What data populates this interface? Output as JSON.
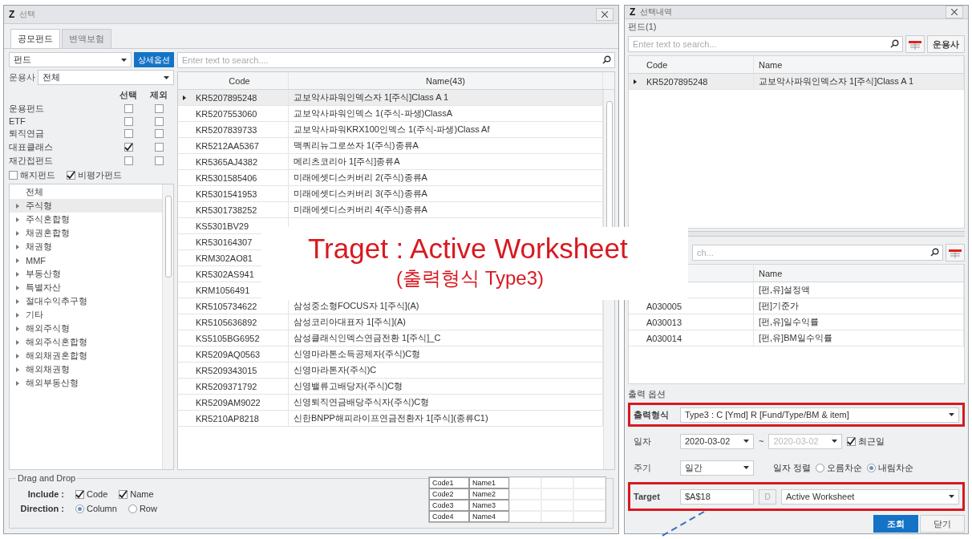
{
  "left_window": {
    "logo": "Z",
    "title": "선택",
    "tabs": [
      {
        "label": "공모펀드",
        "selected": true
      },
      {
        "label": "변액보험",
        "selected": false
      }
    ],
    "fund_type": {
      "value": "펀드"
    },
    "detail_button": "상세옵션",
    "manager": {
      "label": "운용사",
      "value": "전체"
    },
    "filter_headers": [
      "선택",
      "제외"
    ],
    "filters": [
      {
        "label": "운용펀드",
        "select": false,
        "exclude": false
      },
      {
        "label": "ETF",
        "select": false,
        "exclude": false
      },
      {
        "label": "퇴직연금",
        "select": false,
        "exclude": false
      },
      {
        "label": "대표클래스",
        "select": true,
        "exclude": false
      },
      {
        "label": "재간접펀드",
        "select": false,
        "exclude": false
      }
    ],
    "extra_checks": [
      {
        "label": "해지펀드",
        "checked": false
      },
      {
        "label": "비평가펀드",
        "checked": true
      }
    ],
    "categories": [
      {
        "label": "전체",
        "kind": "all",
        "selected": false
      },
      {
        "label": "주식형",
        "kind": "group",
        "selected": true
      },
      {
        "label": "주식혼합형",
        "kind": "group",
        "selected": false
      },
      {
        "label": "채권혼합형",
        "kind": "group",
        "selected": false
      },
      {
        "label": "채권형",
        "kind": "group",
        "selected": false
      },
      {
        "label": "MMF",
        "kind": "group",
        "selected": false
      },
      {
        "label": "부동산형",
        "kind": "group",
        "selected": false
      },
      {
        "label": "특별자산",
        "kind": "group",
        "selected": false
      },
      {
        "label": "절대수익추구형",
        "kind": "group",
        "selected": false
      },
      {
        "label": "기타",
        "kind": "group",
        "selected": false
      },
      {
        "label": "해외주식형",
        "kind": "group",
        "selected": false
      },
      {
        "label": "해외주식혼합형",
        "kind": "group",
        "selected": false
      },
      {
        "label": "해외채권혼합형",
        "kind": "group",
        "selected": false
      },
      {
        "label": "해외채권형",
        "kind": "group",
        "selected": false
      },
      {
        "label": "해외부동산형",
        "kind": "group",
        "selected": false
      }
    ],
    "search": {
      "placeholder": "Enter text to search...."
    },
    "table": {
      "columns": [
        "Code",
        "Name(43)"
      ],
      "rows": [
        {
          "code": "KR5207895248",
          "name": "교보악사파워인덱스자 1[주식]Class A 1",
          "current": true
        },
        {
          "code": "KR5207553060",
          "name": "교보악사파워인덱스 1(주식-파생)ClassA",
          "current": false
        },
        {
          "code": "KR5207839733",
          "name": "교보악사파워KRX100인덱스 1(주식-파생)Class Af",
          "current": false
        },
        {
          "code": "KR5212AA5367",
          "name": "맥쿼리뉴그로쓰자 1(주식)종류A",
          "current": false
        },
        {
          "code": "KR5365AJ4382",
          "name": "메리츠코리아 1[주식]종류A",
          "current": false
        },
        {
          "code": "KR5301585406",
          "name": "미래에셋디스커버리 2(주식)종류A",
          "current": false
        },
        {
          "code": "KR5301541953",
          "name": "미래에셋디스커버리 3(주식)종류A",
          "current": false
        },
        {
          "code": "KR5301738252",
          "name": "미래에셋디스커버리 4(주식)종류A",
          "current": false
        },
        {
          "code": "KS5301BV29",
          "current": false
        },
        {
          "code": "KR530164307",
          "current": false
        },
        {
          "code": "KRM302AO81",
          "current": false
        },
        {
          "code": "KR5302AS941",
          "current": false
        },
        {
          "code": "KRM1056491",
          "current": false
        },
        {
          "code": "KR5105734622",
          "name": "삼성중소형FOCUS자 1[주식](A)",
          "current": false
        },
        {
          "code": "KR5105636892",
          "name": "삼성코리아대표자 1[주식](A)",
          "current": false
        },
        {
          "code": "KS5105BG6952",
          "name": "삼성클래식인덱스연금전환 1[주식]_C",
          "current": false
        },
        {
          "code": "KR5209AQ0563",
          "name": "신영마라톤소득공제자(주식)C형",
          "current": false
        },
        {
          "code": "KR5209343015",
          "name": "신영마라톤자(주식)C",
          "current": false
        },
        {
          "code": "KR5209371792",
          "name": "신영밸류고배당자(주식)C형",
          "current": false
        },
        {
          "code": "KR5209AM9022",
          "name": "신영퇴직연금배당주식자(주식)C형",
          "current": false
        },
        {
          "code": "KR5210AP8218",
          "name": "신한BNPP해피라이프연금전환자 1[주식](종류C1)",
          "current": false
        }
      ]
    },
    "drag_drop": {
      "title": "Drag and Drop",
      "include": {
        "label": "Include :",
        "options": [
          {
            "label": "Code",
            "checked": true
          },
          {
            "label": "Name",
            "checked": true
          }
        ]
      },
      "direction": {
        "label": "Direction :",
        "options": [
          {
            "label": "Column",
            "selected": true
          },
          {
            "label": "Row",
            "selected": false
          }
        ]
      },
      "preview": [
        {
          "code": "Code1",
          "name": "Name1"
        },
        {
          "code": "Code2",
          "name": "Name2"
        },
        {
          "code": "Code3",
          "name": "Name3"
        },
        {
          "code": "Code4",
          "name": "Name4"
        }
      ]
    }
  },
  "right_window": {
    "logo": "Z",
    "title": "선택내역",
    "group_title": "펀드(1)",
    "search": {
      "placeholder": "Enter text to search..."
    },
    "manager_button": "운용사",
    "table": {
      "columns": [
        "Code",
        "Name"
      ],
      "rows": [
        {
          "code": "KR5207895248",
          "name": "교보악사파워인덱스자 1[주식]Class A 1",
          "current": true
        }
      ]
    },
    "items": {
      "search": {
        "placeholder": "ch..."
      },
      "name_header": "Name",
      "rows": [
        {
          "name": "[펀,유]설정액"
        },
        {
          "code": "A030005",
          "name": "[펀]기준가"
        },
        {
          "code": "A030013",
          "name": "[펀,유]일수익률"
        },
        {
          "code": "A030014",
          "name": "[펀,유]BM일수익률"
        }
      ]
    },
    "options": {
      "title": "출력 옵션",
      "format": {
        "label": "출력형식",
        "value": "Type3 : C [Ymd] R [Fund/Type/BM & item]",
        "highlighted": true
      },
      "date": {
        "label": "일자",
        "from": "2020-03-02",
        "separator": "~",
        "to": "2020-03-02",
        "latest": {
          "label": "최근일",
          "checked": true
        }
      },
      "period": {
        "label": "주기",
        "value": "일간"
      },
      "sort": {
        "label": "일자 정렬",
        "options": [
          {
            "label": "오름차순",
            "selected": false
          },
          {
            "label": "내림차순",
            "selected": true
          }
        ]
      },
      "target": {
        "label": "Target",
        "cell": "$A$18",
        "button": "D",
        "value": "Active Worksheet",
        "highlighted": true
      }
    },
    "buttons": [
      {
        "label": "조회",
        "primary": true
      },
      {
        "label": "닫기",
        "primary": false
      }
    ]
  },
  "callout": {
    "title": "Traget : Active Worksheet",
    "subtitle": "(출력형식 Type3)"
  }
}
